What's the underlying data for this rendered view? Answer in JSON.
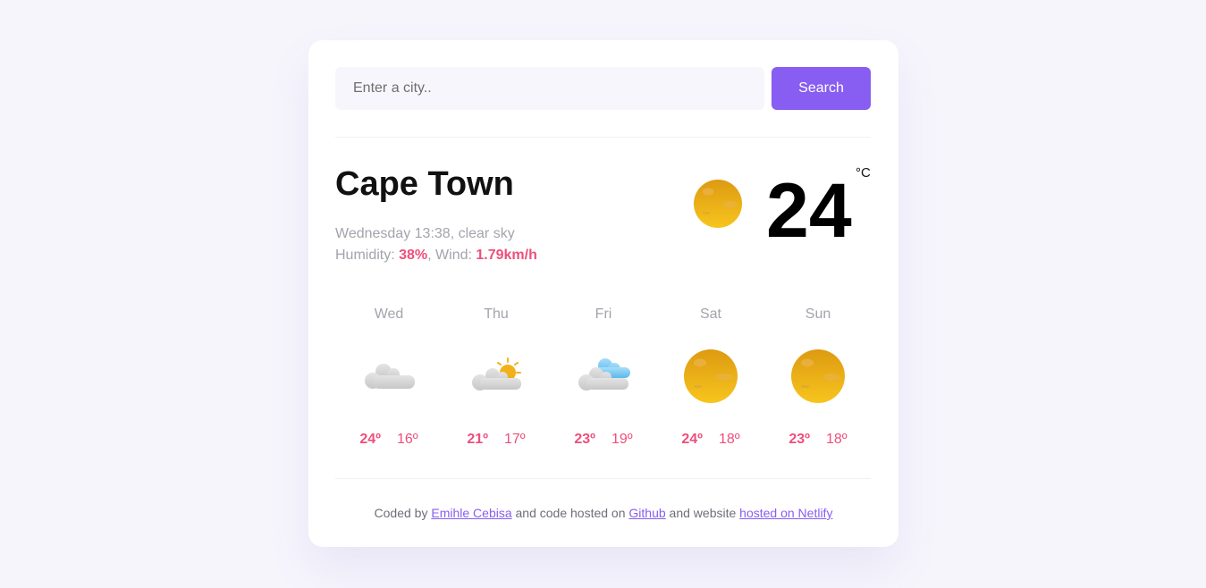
{
  "search": {
    "placeholder": "Enter a city..",
    "button_label": "Search"
  },
  "current": {
    "city": "Cape Town",
    "datetime_description": "Wednesday 13:38, clear sky",
    "humidity_label": "Humidity: ",
    "humidity_value": "38%",
    "wind_label": ", Wind: ",
    "wind_value": "1.79km/h",
    "temperature": "24",
    "unit": "°C",
    "icon": "sun-icon"
  },
  "forecast": [
    {
      "day": "Wed",
      "icon": "cloud-icon",
      "max": "24º",
      "min": "16º"
    },
    {
      "day": "Thu",
      "icon": "partly-sunny-icon",
      "max": "21º",
      "min": "17º"
    },
    {
      "day": "Fri",
      "icon": "cloud-showers-icon",
      "max": "23º",
      "min": "19º"
    },
    {
      "day": "Sat",
      "icon": "sun-icon",
      "max": "24º",
      "min": "18º"
    },
    {
      "day": "Sun",
      "icon": "sun-icon",
      "max": "23º",
      "min": "18º"
    }
  ],
  "footer": {
    "prefix": "Coded by ",
    "author_link": "Emihle Cebisa",
    "middle": " and code hosted on ",
    "github_link": "Github",
    "middle2": " and website ",
    "netlify_link": "hosted on Netlify"
  },
  "colors": {
    "accent": "#885df1",
    "highlight": "#ee4f7c",
    "background": "#f6f5fc"
  }
}
